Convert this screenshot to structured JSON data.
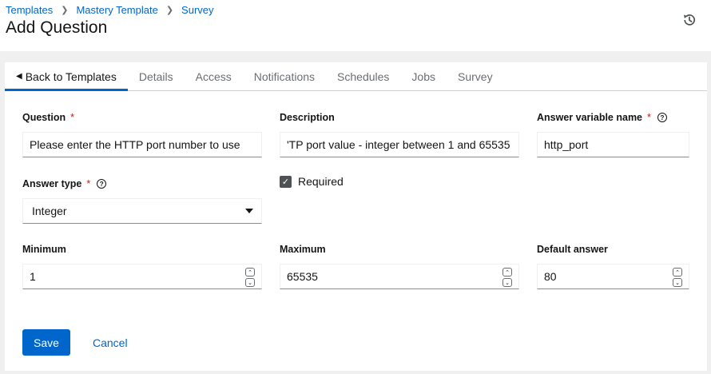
{
  "breadcrumb": {
    "items": [
      "Templates",
      "Mastery Template",
      "Survey"
    ]
  },
  "page": {
    "title": "Add Question"
  },
  "tabs": [
    {
      "label": "Back to Templates"
    },
    {
      "label": "Details"
    },
    {
      "label": "Access"
    },
    {
      "label": "Notifications"
    },
    {
      "label": "Schedules"
    },
    {
      "label": "Jobs"
    },
    {
      "label": "Survey"
    }
  ],
  "form": {
    "question": {
      "label": "Question",
      "required_mark": "*",
      "value": "Please enter the HTTP port number to use"
    },
    "description": {
      "label": "Description",
      "value": "'TP port value - integer between 1 and 65535"
    },
    "variable": {
      "label": "Answer variable name",
      "required_mark": "*",
      "help": "?",
      "value": "http_port"
    },
    "answer_type": {
      "label": "Answer type",
      "required_mark": "*",
      "help": "?",
      "value": "Integer"
    },
    "required": {
      "label": "Required",
      "checked": true,
      "check": "✓"
    },
    "minimum": {
      "label": "Minimum",
      "value": "1"
    },
    "maximum": {
      "label": "Maximum",
      "value": "65535"
    },
    "default": {
      "label": "Default answer",
      "value": "80"
    },
    "spin_up": "⌃",
    "spin_down": "⌄"
  },
  "actions": {
    "save": "Save",
    "cancel": "Cancel"
  },
  "colors": {
    "primary": "#0066cc",
    "required": "#c9190b",
    "text": "#151515",
    "muted": "#6a6e73"
  },
  "icons": {
    "history": "history-icon",
    "back": "caret-left-icon",
    "help": "question-circle-icon",
    "select": "caret-down-icon"
  }
}
